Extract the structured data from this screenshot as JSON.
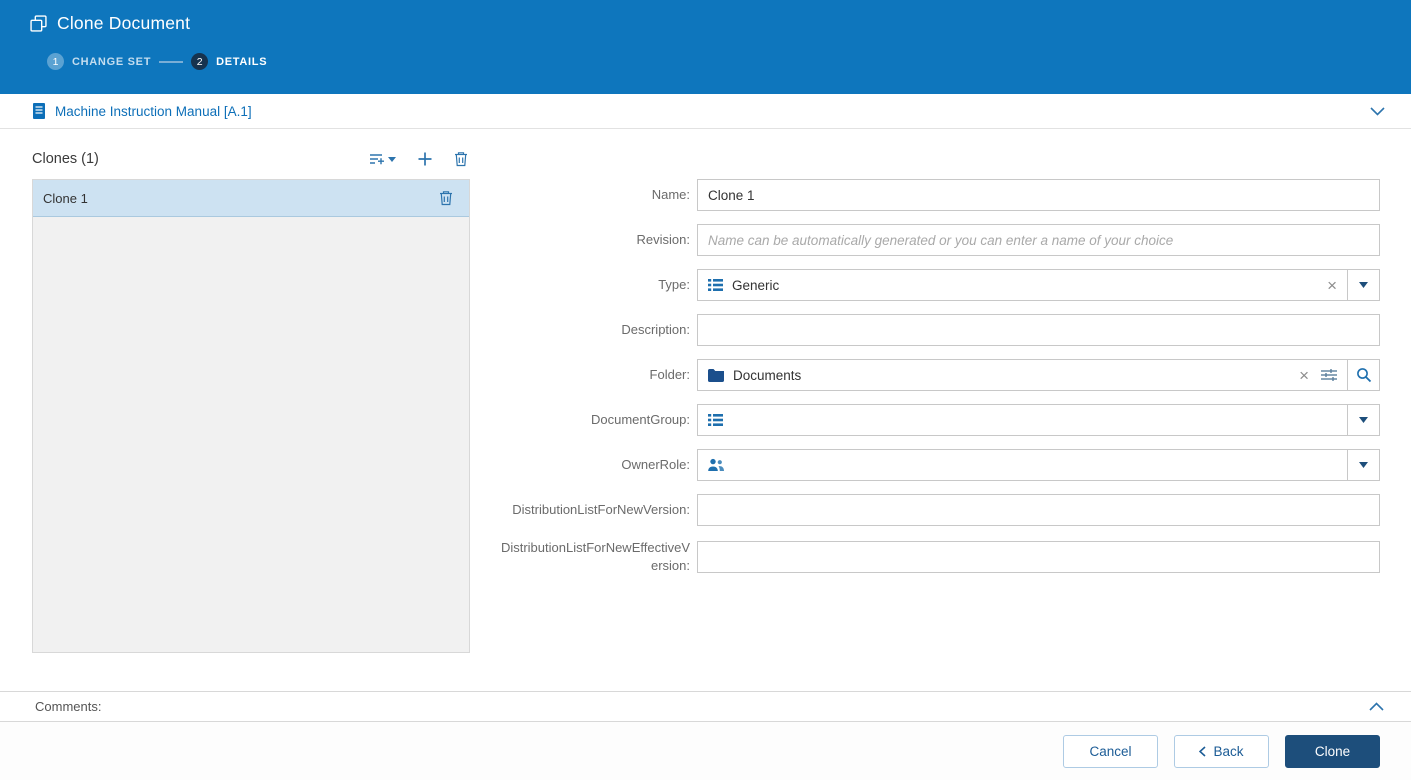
{
  "header": {
    "title": "Clone Document",
    "steps": [
      {
        "number": "1",
        "label": "CHANGE SET",
        "active": false
      },
      {
        "number": "2",
        "label": "DETAILS",
        "active": true
      }
    ]
  },
  "document_bar": {
    "title": "Machine Instruction Manual [A.1]"
  },
  "clones_panel": {
    "title": "Clones (1)",
    "items": [
      {
        "label": "Clone 1",
        "selected": true
      }
    ]
  },
  "form": {
    "fields": [
      {
        "label": "Name:",
        "value": "Clone 1"
      },
      {
        "label": "Revision:",
        "value": "",
        "placeholder": "Name can be automatically generated or you can enter a name of your choice"
      },
      {
        "label": "Type:",
        "value": "Generic",
        "icon": "list-icon"
      },
      {
        "label": "Description:",
        "value": ""
      },
      {
        "label": "Folder:",
        "value": "Documents",
        "icon": "folder-icon"
      },
      {
        "label": "DocumentGroup:",
        "value": "",
        "icon": "list-icon"
      },
      {
        "label": "OwnerRole:",
        "value": "",
        "icon": "people-icon"
      },
      {
        "label": "DistributionListForNewVersion:",
        "value": ""
      },
      {
        "label": "DistributionListForNewEffectiveVersion:",
        "value": ""
      }
    ]
  },
  "comments": {
    "label": "Comments:"
  },
  "footer": {
    "cancel_label": "Cancel",
    "back_label": "Back",
    "clone_label": "Clone"
  },
  "colors": {
    "header_bg": "#0e76bd",
    "accent_blue": "#0d6fb8",
    "icon_blue": "#2d74ad",
    "primary_button_bg": "#1d4e7b",
    "selected_row_bg": "#cde2f2"
  }
}
